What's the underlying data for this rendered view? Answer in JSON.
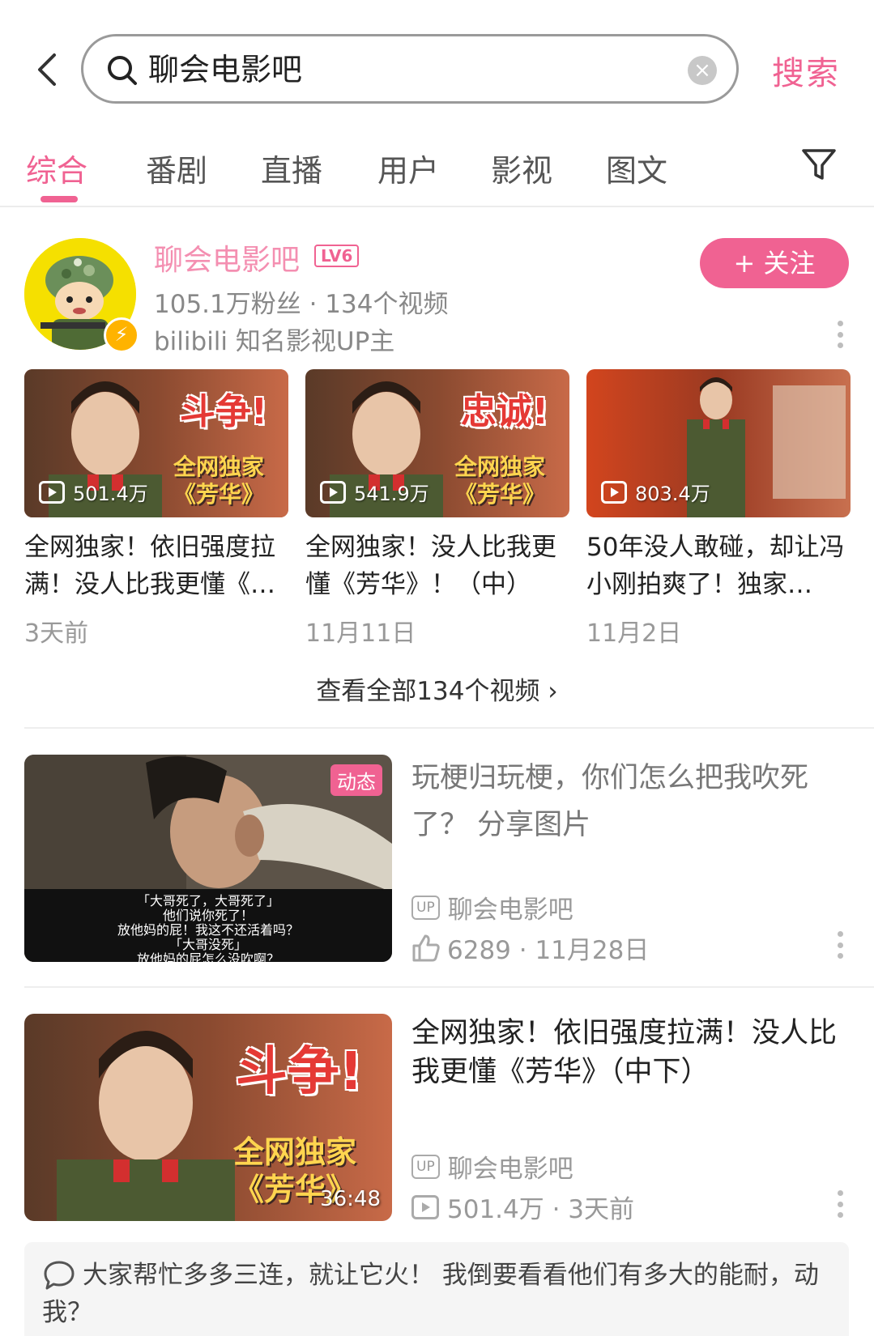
{
  "search": {
    "query": "聊会电影吧",
    "action_label": "搜索"
  },
  "tabs": [
    {
      "label": "综合",
      "active": true
    },
    {
      "label": "番剧",
      "active": false
    },
    {
      "label": "直播",
      "active": false
    },
    {
      "label": "用户",
      "active": false
    },
    {
      "label": "影视",
      "active": false
    },
    {
      "label": "图文",
      "active": false
    }
  ],
  "user_card": {
    "name": "聊会电影吧",
    "level": "LV6",
    "stats": "105.1万粉丝 · 134个视频",
    "description": "bilibili 知名影视UP主",
    "follow_label": "+ 关注",
    "videos": [
      {
        "title": "全网独家！依旧强度拉满！没人比我更懂《…",
        "plays": "501.4万",
        "date": "3天前",
        "thumb_headline": "斗争!",
        "thumb_sub1": "全网独家",
        "thumb_sub2": "《芳华》"
      },
      {
        "title": "全网独家！没人比我更懂《芳华》！（中）",
        "plays": "541.9万",
        "date": "11月11日",
        "thumb_headline": "忠诚!",
        "thumb_sub1": "全网独家",
        "thumb_sub2": "《芳华》"
      },
      {
        "title": "50年没人敢碰，却让冯小刚拍爽了！独家…",
        "plays": "803.4万",
        "date": "11月2日",
        "thumb_headline": "",
        "thumb_sub1": "",
        "thumb_sub2": ""
      }
    ],
    "view_all": "查看全部134个视频 ›"
  },
  "list": [
    {
      "title": "玩梗归玩梗，你们怎么把我吹死了？ 分享图片",
      "badge": "动态",
      "subtitle_lines": [
        "「大哥死了，大哥死了」",
        "他们说你死了！",
        "放他妈的屁！我这不还活着吗？",
        "「大哥没死」",
        "放他妈的屁怎么没吹啊？"
      ],
      "up_tag": "UP",
      "uploader": "聊会电影吧",
      "meta": "6289 · 11月28日"
    },
    {
      "title": "全网独家！依旧强度拉满！没人比我更懂《芳华》（中下）",
      "duration": "36:48",
      "thumb_headline": "斗争!",
      "thumb_sub1": "全网独家",
      "thumb_sub2": "《芳华》",
      "up_tag": "UP",
      "uploader": "聊会电影吧",
      "meta": "501.4万 · 3天前"
    }
  ],
  "comment": {
    "text": "大家帮忙多多三连，就让它火！ 我倒要看看他们有多大的能耐，动我？"
  },
  "colors": {
    "accent": "#f06292",
    "text_gray": "#999999"
  }
}
